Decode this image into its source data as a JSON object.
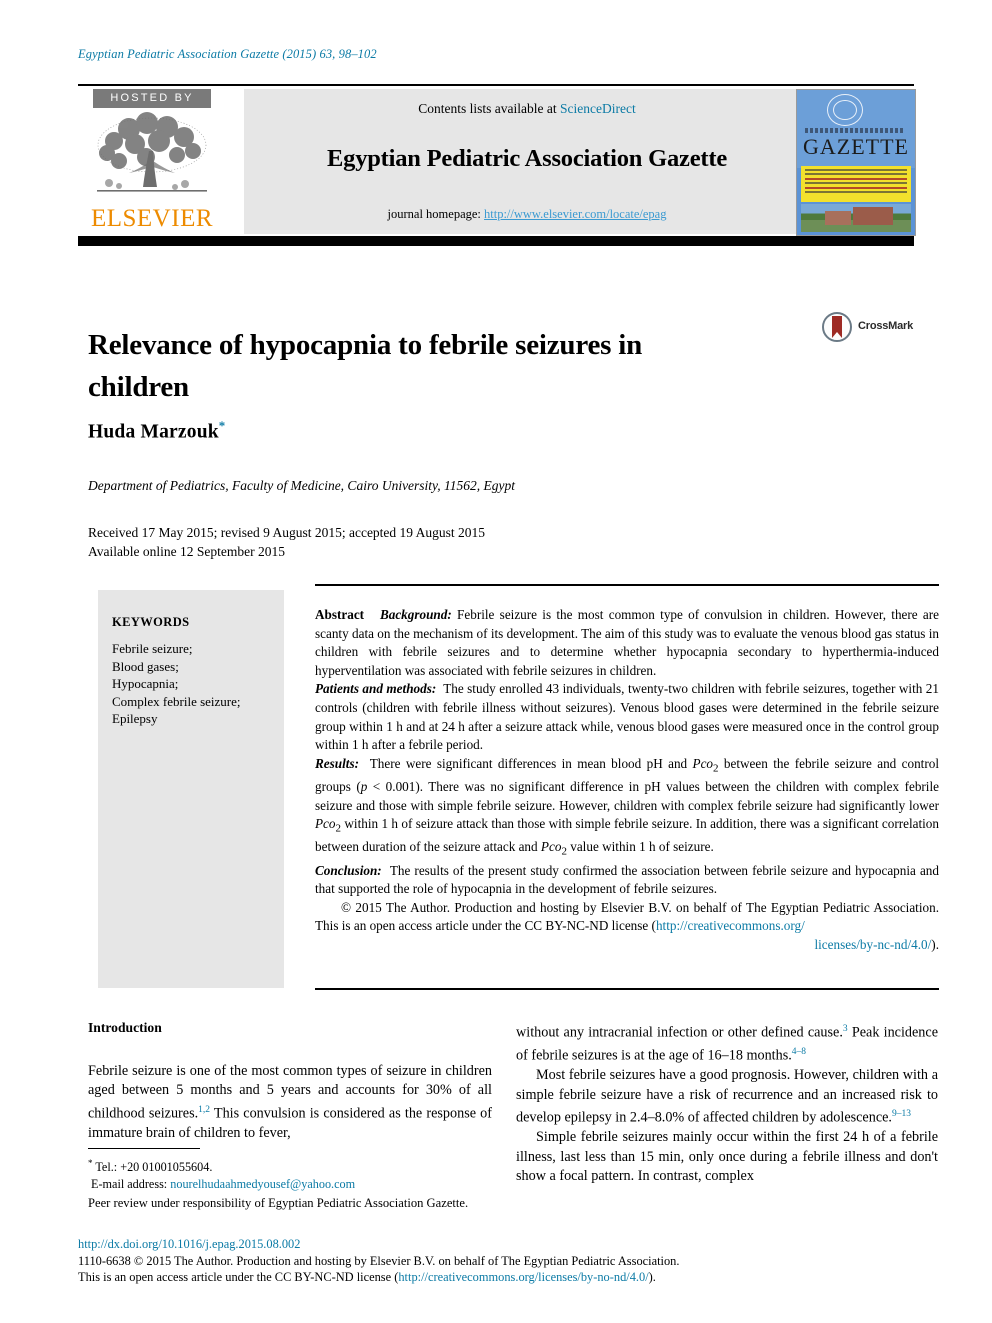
{
  "running_head": "Egyptian Pediatric Association Gazette (2015) 63, 98–102",
  "masthead": {
    "hosted_by": "HOSTED BY",
    "publisher": "ELSEVIER",
    "contents_prefix": "Contents lists available at ",
    "contents_link": "ScienceDirect",
    "journal_title": "Egyptian Pediatric Association Gazette",
    "homepage_label": "journal homepage: ",
    "homepage_url": "http://www.elsevier.com/locate/epag",
    "cover_title": "GAZETTE"
  },
  "article": {
    "title": "Relevance of hypocapnia to febrile seizures in children",
    "crossmark_label": "CrossMark",
    "author": "Huda Marzouk",
    "author_marker": "*",
    "affiliation": "Department of Pediatrics, Faculty of Medicine, Cairo University, 11562, Egypt",
    "received_line": "Received 17 May 2015; revised 9 August 2015; accepted 19 August 2015",
    "available_line": "Available online 12 September 2015"
  },
  "keywords": {
    "heading": "KEYWORDS",
    "items": [
      "Febrile seizure;",
      "Blood gases;",
      "Hypocapnia;",
      "Complex febrile seizure;",
      "Epilepsy"
    ]
  },
  "abstract": {
    "label": "Abstract",
    "background_label": "Background:",
    "background": "Febrile seizure is the most common type of convulsion in children. However, there are scanty data on the mechanism of its development. The aim of this study was to evaluate the venous blood gas status in children with febrile seizures and to determine whether hypocapnia secondary to hyperthermia-induced hyperventilation was associated with febrile seizures in children.",
    "methods_label": "Patients and methods:",
    "methods": "The study enrolled 43 individuals, twenty-two children with febrile seizures, together with 21 controls (children with febrile illness without seizures). Venous blood gases were determined in the febrile seizure group within 1 h and at 24 h after a seizure attack while, venous blood gases were measured once in the control group within 1 h after a febrile period.",
    "results_label": "Results:",
    "results_1": "There were significant differences in mean blood pH and ",
    "results_pco2_a": "Pco",
    "results_sub_a": "2",
    "results_2": " between the febrile seizure and control groups (",
    "results_p_italic": "p",
    "results_3": " < 0.001). There was no significant difference in pH values between the children with complex febrile seizure and those with simple febrile seizure. However, children with complex febrile seizure had significantly lower ",
    "results_pco2_b": "Pco",
    "results_sub_b": "2",
    "results_4": " within 1 h of seizure attack than those with simple febrile seizure. In addition, there was a significant correlation between duration of the seizure attack and ",
    "results_pco2_c": "Pco",
    "results_sub_c": "2",
    "results_5": " value within 1 h of seizure.",
    "conclusion_label": "Conclusion:",
    "conclusion": "The results of the present study confirmed the association between febrile seizure and hypocapnia and that supported the role of hypocapnia in the development of febrile seizures.",
    "copyright_1": "© 2015 The Author. Production and hosting by Elsevier B.V. on behalf of The Egyptian Pediatric Association.  This is an open access article under the CC BY-NC-ND license (",
    "copyright_link_1": "http://creativecommons.org/",
    "copyright_link_2": "licenses/by-nc-nd/4.0/",
    "copyright_2": ")."
  },
  "body": {
    "intro_heading": "Introduction",
    "left_p1_a": "Febrile seizure is one of the most common types of seizure in children aged between 5 months and 5 years and accounts for 30% of all childhood seizures.",
    "left_p1_ref": "1,2",
    "left_p1_b": " This convulsion is considered as the response of immature brain of children to fever,",
    "right_p1_a": "without any intracranial infection or other defined cause.",
    "right_p1_ref1": "3",
    "right_p1_b": " Peak incidence of febrile seizures is at the age of 16–18 months.",
    "right_p1_ref2": "4–8",
    "right_p2_a": "Most febrile seizures have a good prognosis. However, children with a simple febrile seizure have a risk of recurrence and an increased risk to develop epilepsy in 2.4–8.0% of affected children by adolescence.",
    "right_p2_ref": "9–13",
    "right_p3": "Simple febrile seizures mainly occur within the first 24 h of a febrile illness, last less than 15 min, only once during a febrile illness and don't show a focal pattern. In contrast, complex"
  },
  "footnote": {
    "tel_marker": "*",
    "tel": " Tel.: +20 01001055604.",
    "email_label": "E-mail address: ",
    "email": "nourelhudaahmedyousef@yahoo.com",
    "peer_review": "Peer review under responsibility of Egyptian Pediatric Association Gazette."
  },
  "legal": {
    "doi": "http://dx.doi.org/10.1016/j.epag.2015.08.002",
    "line1": "1110-6638 © 2015 The Author. Production and hosting by Elsevier B.V. on behalf of The Egyptian Pediatric Association.",
    "line2_pre": "This is an open access article under the CC BY-NC-ND license (",
    "line2_link": "http://creativecommons.org/licenses/by-no-nd/4.0/",
    "line2_post": ")."
  },
  "colors": {
    "link": "#0b7aa5",
    "elsevier_orange": "#ED8B00",
    "panel_gray": "#e6e6e6"
  }
}
